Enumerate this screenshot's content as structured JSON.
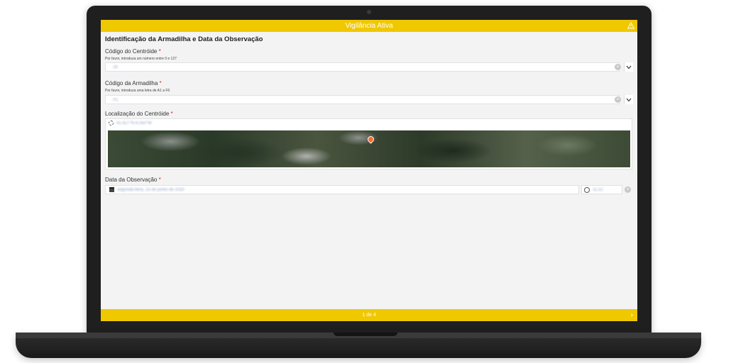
{
  "app": {
    "title": "Vigilância Ativa",
    "header_icon": "warning-icon",
    "brand_color": "#f0c800"
  },
  "form": {
    "title": "Identificação da Armadilha e Data da Observação",
    "required_marker": "*",
    "fields": {
      "centroid_code": {
        "label": "Código do Centróide",
        "hint": "Por favor, introduza um número entre 0 e 127",
        "value": "18"
      },
      "trap_code": {
        "label": "Código da Armadilha",
        "hint": "Por favor, introduza uma letra de A1 a F6",
        "value": "A1"
      },
      "centroid_location": {
        "label": "Localização do Centróide",
        "value": "41.427°N 8.350°W"
      },
      "observation_date": {
        "label": "Data da Observação",
        "date_value": "segunda-feira, 15 de junho de 2020",
        "time_value": "11:22"
      }
    }
  },
  "footer": {
    "page_indicator": "1 de 4",
    "next_icon": "chevron-right-icon"
  }
}
